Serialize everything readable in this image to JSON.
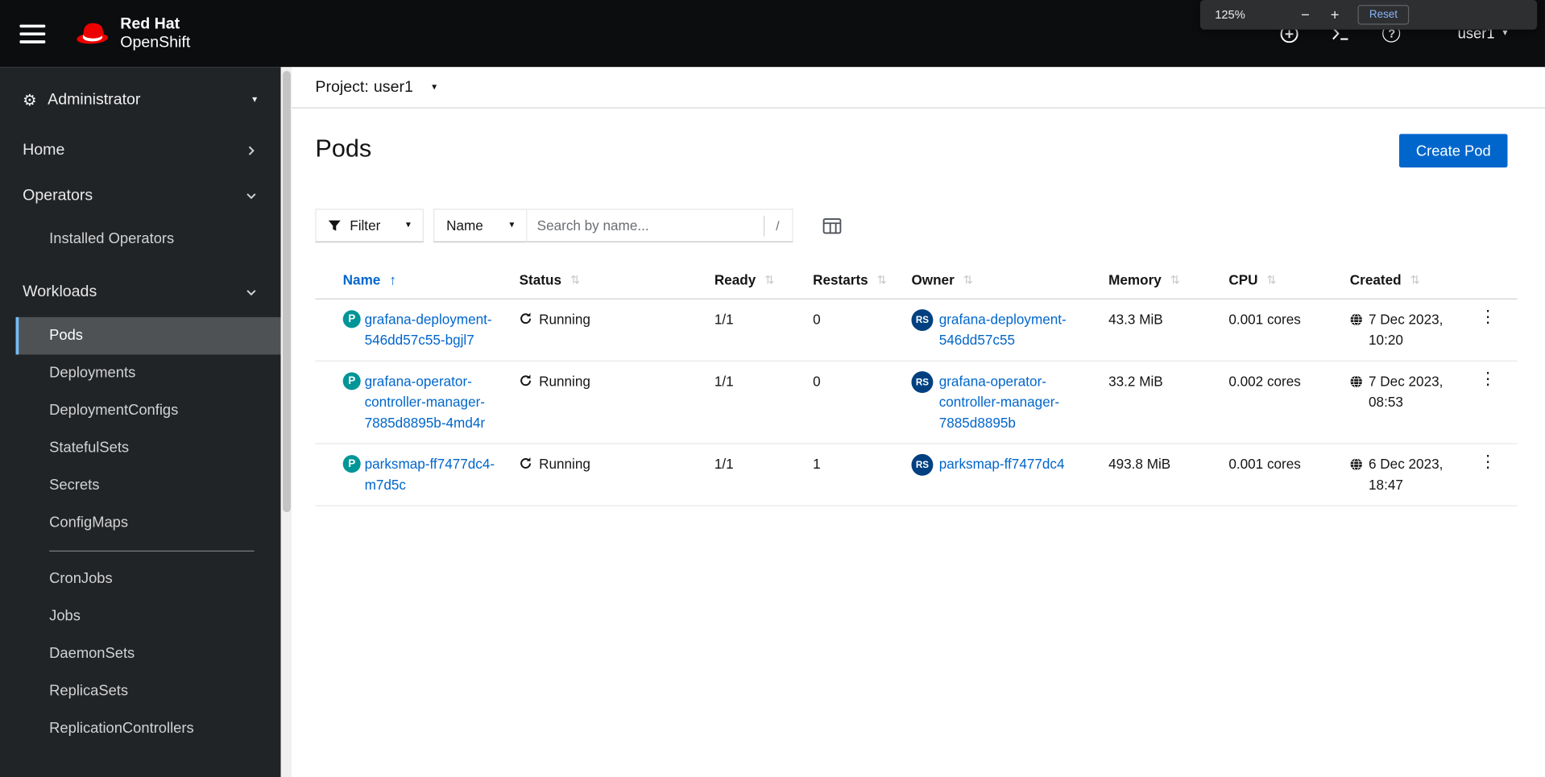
{
  "zoom": {
    "level": "125%",
    "minus": "−",
    "plus": "+",
    "reset": "Reset"
  },
  "masthead": {
    "brand_top": "Red Hat",
    "brand_bottom": "OpenShift",
    "user": "user1"
  },
  "icons": {
    "caret_down": "▾",
    "gear": "⚙",
    "question": "?",
    "kebab": "⋮",
    "sort_asc": "↑",
    "sort_both": "⇅"
  },
  "sidebar": {
    "perspective": "Administrator",
    "home": "Home",
    "operators": "Operators",
    "operators_items": [
      "Installed Operators"
    ],
    "workloads": "Workloads",
    "workloads_items": [
      "Pods",
      "Deployments",
      "DeploymentConfigs",
      "StatefulSets",
      "Secrets",
      "ConfigMaps",
      "CronJobs",
      "Jobs",
      "DaemonSets",
      "ReplicaSets",
      "ReplicationControllers"
    ],
    "active_item": "Pods"
  },
  "project": {
    "label": "Project:",
    "name": "user1"
  },
  "page": {
    "title": "Pods",
    "create_button": "Create Pod"
  },
  "toolbar": {
    "filter": "Filter",
    "filter_by": "Name",
    "search_placeholder": "Search by name...",
    "shortcut": "/"
  },
  "table": {
    "columns": [
      "Name",
      "Status",
      "Ready",
      "Restarts",
      "Owner",
      "Memory",
      "CPU",
      "Created"
    ],
    "sorted_by": "Name",
    "sort_direction": "ascending",
    "rows": [
      {
        "badge": "P",
        "name": "grafana-deployment-546dd57c55-bgjl7",
        "status": "Running",
        "ready": "1/1",
        "restarts": "0",
        "owner_badge": "RS",
        "owner": "grafana-deployment-546dd57c55",
        "memory": "43.3 MiB",
        "cpu": "0.001 cores",
        "created": "7 Dec 2023, 10:20"
      },
      {
        "badge": "P",
        "name": "grafana-operator-controller-manager-7885d8895b-4md4r",
        "status": "Running",
        "ready": "1/1",
        "restarts": "0",
        "owner_badge": "RS",
        "owner": "grafana-operator-controller-manager-7885d8895b",
        "memory": "33.2 MiB",
        "cpu": "0.002 cores",
        "created": "7 Dec 2023, 08:53"
      },
      {
        "badge": "P",
        "name": "parksmap-ff7477dc4-m7d5c",
        "status": "Running",
        "ready": "1/1",
        "restarts": "1",
        "owner_badge": "RS",
        "owner": "parksmap-ff7477dc4",
        "memory": "493.8 MiB",
        "cpu": "0.001 cores",
        "created": "6 Dec 2023, 18:47"
      }
    ]
  },
  "colors": {
    "accent": "#0066cc",
    "pod_badge": "#009596",
    "replicaset_badge": "#004080",
    "active_nav_border": "#73bcf7",
    "masthead_bg": "#0c0d0e",
    "sidebar_bg": "#212427"
  }
}
